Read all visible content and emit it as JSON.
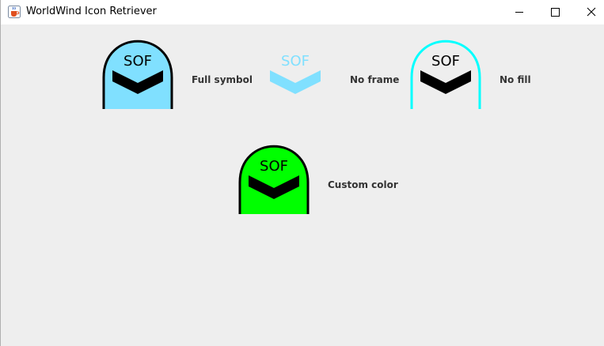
{
  "window": {
    "title": "WorldWind Icon Retriever",
    "icon": "java-cup-icon",
    "controls": {
      "minimize_icon": "minimize-icon",
      "maximize_icon": "maximize-icon",
      "close_icon": "close-icon"
    }
  },
  "symbols": [
    {
      "id": "full-symbol",
      "symbol_text": "SOF",
      "label": "Full symbol",
      "frame": true,
      "fill": true,
      "fill_color": "#80E0FF",
      "frame_color": "#000000",
      "chevron_color": "#000000",
      "text_color": "#000000"
    },
    {
      "id": "no-frame",
      "symbol_text": "SOF",
      "label": "No frame",
      "frame": false,
      "fill": true,
      "fill_color": "#80E0FF",
      "chevron_color": "#80E0FF",
      "text_color": "#80E0FF"
    },
    {
      "id": "no-fill",
      "symbol_text": "SOF",
      "label": "No fill",
      "frame": true,
      "fill": false,
      "frame_color": "#00FFFF",
      "chevron_color": "#000000",
      "text_color": "#000000"
    },
    {
      "id": "custom-color",
      "symbol_text": "SOF",
      "label": "Custom color",
      "frame": true,
      "fill": true,
      "fill_color": "#00FF00",
      "frame_color": "#000000",
      "chevron_color": "#000000",
      "text_color": "#000000"
    }
  ]
}
